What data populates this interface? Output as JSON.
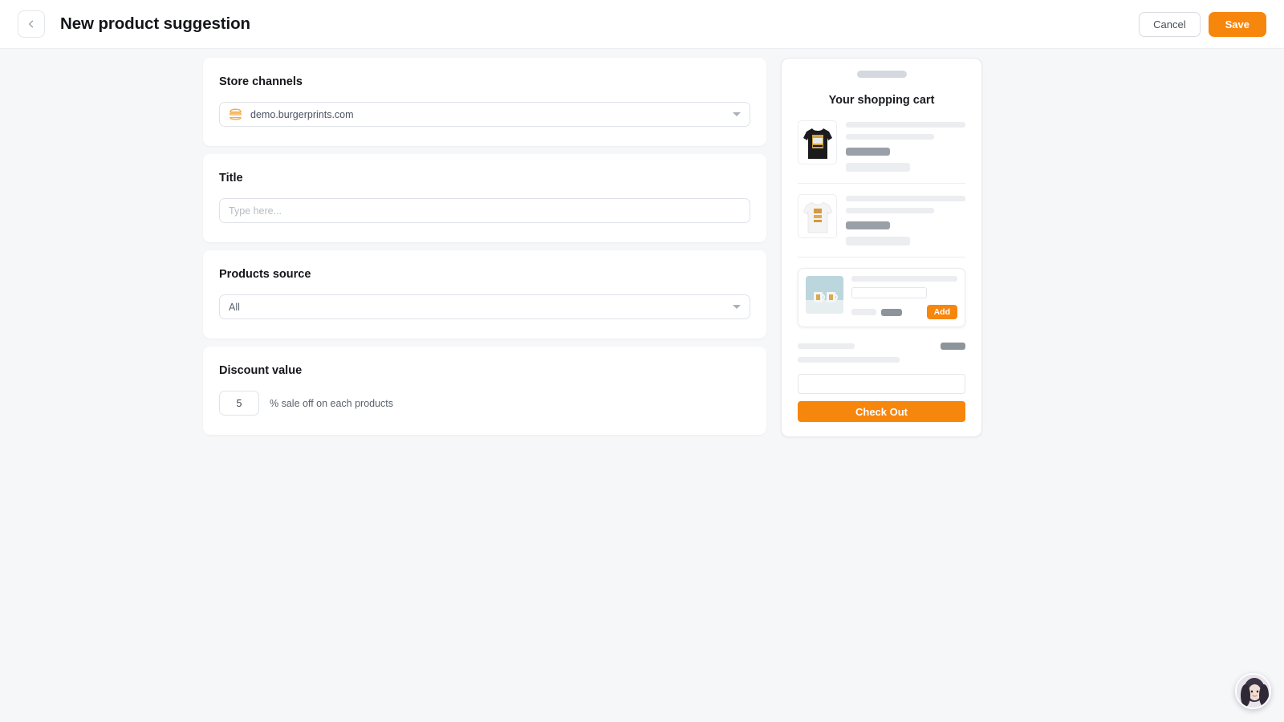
{
  "header": {
    "back_icon": "chevron-left-icon",
    "title": "New product suggestion",
    "cancel_label": "Cancel",
    "save_label": "Save"
  },
  "form": {
    "store_channels": {
      "label": "Store channels",
      "icon": "burger-icon",
      "value": "demo.burgerprints.com",
      "caret_icon": "chevron-down-icon"
    },
    "title": {
      "label": "Title",
      "value": "",
      "placeholder": "Type here..."
    },
    "products_source": {
      "label": "Products source",
      "value": "All",
      "caret_icon": "chevron-down-icon"
    },
    "discount_value": {
      "label": "Discount value",
      "value": "5",
      "suffix": "% sale off on each products"
    }
  },
  "preview": {
    "title": "Your shopping cart",
    "items": [
      {
        "thumb": "black-tshirt-thumbnail"
      },
      {
        "thumb": "white-tshirt-thumbnail"
      }
    ],
    "upsell": {
      "thumb": "mug-pair-thumbnail",
      "add_label": "Add"
    },
    "checkout_label": "Check Out"
  },
  "chat": {
    "avatar": "support-agent-avatar"
  },
  "colors": {
    "accent": "#f7860d",
    "page_bg": "#f6f7f9",
    "card_bg": "#ffffff",
    "text": "#15161a",
    "muted": "#5b626e",
    "skeleton_light": "#ebedf0",
    "skeleton_dark": "#9aa0a8"
  }
}
